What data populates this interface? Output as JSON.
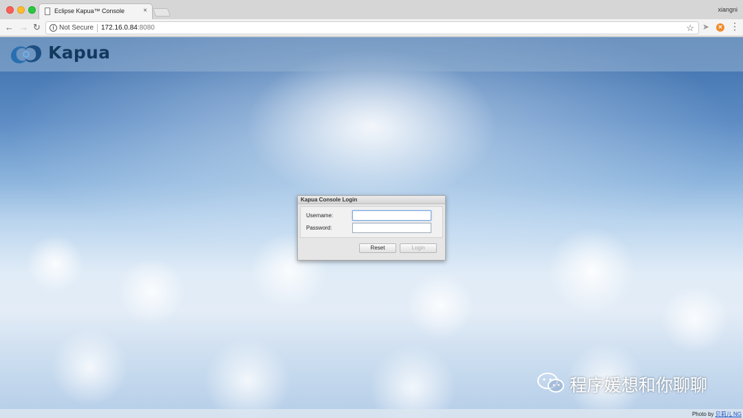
{
  "browser": {
    "tab_title": "Eclipse Kapua™ Console",
    "tab_close": "×",
    "profile_name": "xiangni",
    "security_label": "Not Secure",
    "url_host": "172.16.0.84",
    "url_port": ":8080",
    "back_glyph": "←",
    "forward_glyph": "→",
    "reload_glyph": "↻",
    "star_glyph": "☆",
    "menu_glyph": "⋮"
  },
  "header": {
    "logo_text": "Kapua"
  },
  "login": {
    "title": "Kapua Console Login",
    "username_label": "Username:",
    "password_label": "Password:",
    "username_value": "",
    "password_value": "",
    "reset_label": "Reset",
    "login_label": "Login"
  },
  "watermark": {
    "text": "程序媛想和你聊聊"
  },
  "footer": {
    "photo_by": "Photo by",
    "photo_author": "贝莉儿 NG"
  },
  "colors": {
    "logo": "#123a5e",
    "sky_top": "#3b6ca8",
    "link": "#1a4fc0"
  }
}
